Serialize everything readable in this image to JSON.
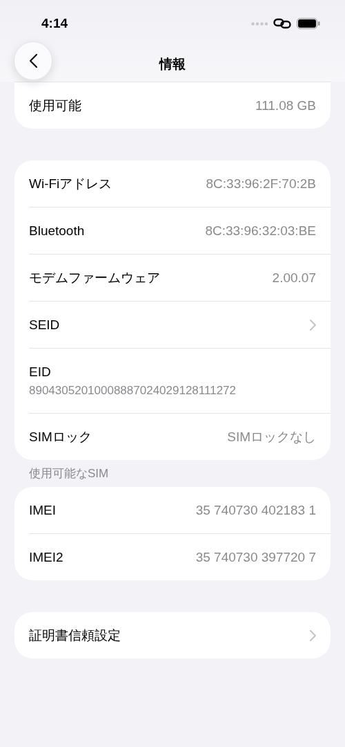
{
  "status_bar": {
    "time": "4:14"
  },
  "nav": {
    "title": "情報"
  },
  "groups": [
    {
      "rows": [
        {
          "kind": "value",
          "label": "使用可能",
          "value": "111.08 GB"
        }
      ]
    },
    {
      "rows": [
        {
          "kind": "value",
          "label": "Wi-Fiアドレス",
          "value": "8C:33:96:2F:70:2B"
        },
        {
          "kind": "value",
          "label": "Bluetooth",
          "value": "8C:33:96:32:03:BE"
        },
        {
          "kind": "value",
          "label": "モデムファームウェア",
          "value": "2.00.07"
        },
        {
          "kind": "chevron",
          "label": "SEID"
        },
        {
          "kind": "stacked",
          "label": "EID",
          "value": "89043052010008887024029128111272"
        },
        {
          "kind": "value",
          "label": "SIMロック",
          "value": "SIMロックなし"
        }
      ]
    },
    {
      "header": "使用可能なSIM",
      "rows": [
        {
          "kind": "value",
          "label": "IMEI",
          "value": "35 740730 402183 1"
        },
        {
          "kind": "value",
          "label": "IMEI2",
          "value": "35 740730 397720 7"
        }
      ]
    },
    {
      "rows": [
        {
          "kind": "chevron",
          "label": "証明書信頼設定"
        }
      ]
    }
  ]
}
